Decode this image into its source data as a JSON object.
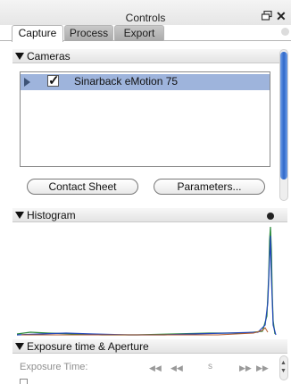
{
  "window": {
    "title": "Controls",
    "float_icon": "float-window-icon",
    "close_icon": "close-icon"
  },
  "tabs": [
    {
      "label": "Capture",
      "active": true
    },
    {
      "label": "Process",
      "active": false
    },
    {
      "label": "Export",
      "active": false
    }
  ],
  "cameras": {
    "header": "Cameras",
    "items": [
      {
        "label": "Sinarback eMotion 75",
        "checked": true,
        "selected": true
      }
    ],
    "buttons": {
      "contact_sheet": "Contact Sheet",
      "parameters": "Parameters..."
    }
  },
  "histogram": {
    "header": "Histogram",
    "info_icon": "info-icon"
  },
  "exposure": {
    "header": "Exposure time & Aperture",
    "label": "Exposure Time:",
    "value": "s"
  },
  "colors": {
    "selection": "#9eb4dc",
    "scroll_thumb": "#2f68c9",
    "histogram_green": "#2a8a3c",
    "histogram_blue": "#2146b8"
  }
}
